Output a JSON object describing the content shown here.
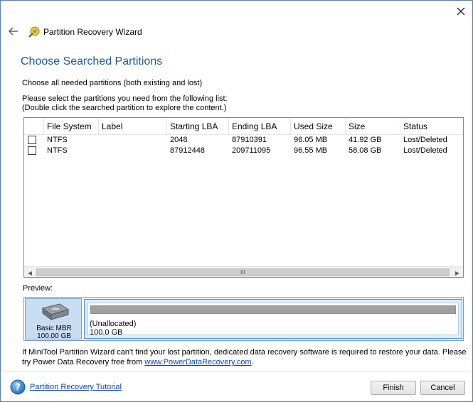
{
  "window": {
    "title": "Partition Recovery Wizard"
  },
  "page": {
    "heading": "Choose Searched Partitions",
    "instruction": "Choose all needed partitions (both existing and lost)",
    "select_line1": "Please select the partitions you need from the following list:",
    "select_line2": "(Double click the searched partition to explore the content.)"
  },
  "table": {
    "columns": [
      "File System",
      "Label",
      "Starting LBA",
      "Ending LBA",
      "Used Size",
      "Size",
      "Status"
    ],
    "rows": [
      {
        "checked": false,
        "file_system": "NTFS",
        "label": "",
        "starting_lba": "2048",
        "ending_lba": "87910391",
        "used_size": "96.05 MB",
        "size": "41.92 GB",
        "status": "Lost/Deleted"
      },
      {
        "checked": false,
        "file_system": "NTFS",
        "label": "",
        "starting_lba": "87912448",
        "ending_lba": "209711095",
        "used_size": "96.55 MB",
        "size": "58.08 GB",
        "status": "Lost/Deleted"
      }
    ],
    "scroll_grip": "III"
  },
  "preview": {
    "label": "Preview:",
    "disk_type": "Basic MBR",
    "disk_size": "100.00 GB",
    "partition_name": "(Unallocated)",
    "partition_size": "100.0 GB"
  },
  "notice": {
    "text1": "If MiniTool Partition Wizard can't find your lost partition, dedicated data recovery software is required to restore your data. Please try Power Data Recovery free from ",
    "link": "www.PowerDataRecovery.com",
    "text2": "."
  },
  "footer": {
    "tutorial_link": "Partition Recovery Tutorial",
    "finish_label": "Finish",
    "cancel_label": "Cancel"
  }
}
